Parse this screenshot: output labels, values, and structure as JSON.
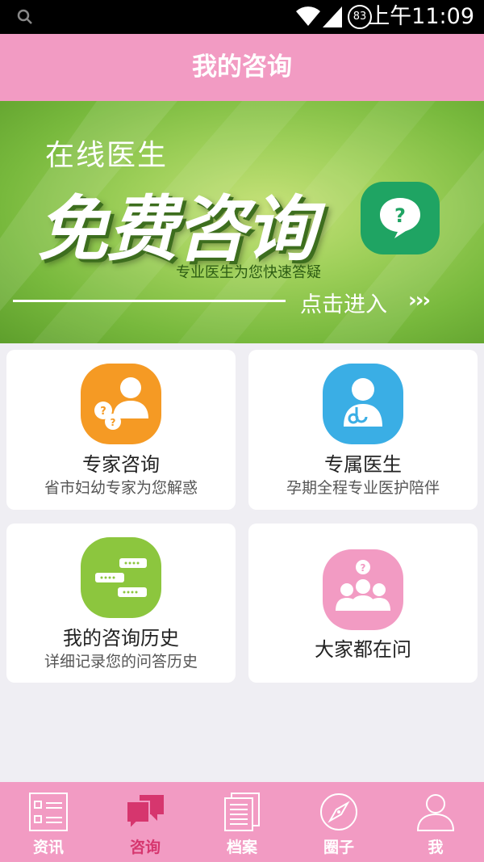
{
  "status_bar": {
    "battery": "83",
    "time": "上午11:09"
  },
  "header": {
    "title": "我的咨询"
  },
  "banner": {
    "subtitle": "在线医生",
    "headline": "免费咨询",
    "tagline": "专业医生为您快速答疑",
    "enter": "点击进入",
    "arrows": "›››"
  },
  "cards": [
    {
      "title": "专家咨询",
      "desc": "省市妇幼专家为您解惑",
      "icon": "expert-consult-icon",
      "color": "#f59a24"
    },
    {
      "title": "专属医生",
      "desc": "孕期全程专业医护陪伴",
      "icon": "doctor-icon",
      "color": "#3aaee5"
    },
    {
      "title": "我的咨询历史",
      "desc": "详细记录您的问答历史",
      "icon": "chat-history-icon",
      "color": "#8cc63e"
    },
    {
      "title": "大家都在问",
      "desc": "",
      "icon": "group-question-icon",
      "color": "#f29bc3"
    }
  ],
  "tabs": [
    {
      "label": "资讯",
      "icon": "news-icon"
    },
    {
      "label": "咨询",
      "icon": "consult-icon",
      "active": true
    },
    {
      "label": "档案",
      "icon": "records-icon"
    },
    {
      "label": "圈子",
      "icon": "compass-icon"
    },
    {
      "label": "我",
      "icon": "profile-icon"
    }
  ],
  "colors": {
    "primary_pink": "#f29bc3",
    "active_tab": "#d6366e",
    "background": "#efeef3"
  }
}
